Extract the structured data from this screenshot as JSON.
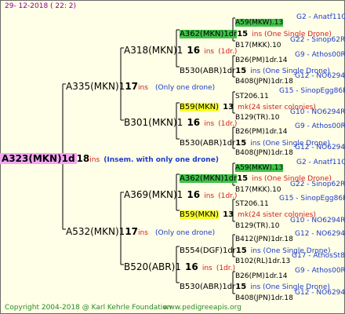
{
  "header": {
    "date": "29- 12-2018 ( 22:  2)"
  },
  "footer": {
    "copyright": "Copyright 2004-2018 @ Karl Kehrle Foundation",
    "site": "www.pedigreeapis.org"
  },
  "root": {
    "label": "A323(MKN)1d",
    "ins": "18",
    "ins_suffix": "ins",
    "note": "(Insem. with only one drone)"
  },
  "level1": [
    {
      "label": "A335(MKN)1",
      "ins": "17",
      "ins_suffix": "ins",
      "note": "(Only one drone)"
    },
    {
      "label": "A532(MKN)1",
      "ins": "17",
      "ins_suffix": "ins",
      "note": "(Only one drone)"
    }
  ],
  "level2": [
    {
      "label": "A318(MKN)1",
      "ins": "16",
      "ins_suffix": "ins",
      "note": "(1dr.)"
    },
    {
      "label": "B301(MKN)1",
      "ins": "16",
      "ins_suffix": "ins",
      "note": "(1dr.)"
    },
    {
      "label": "A369(MKN)1",
      "ins": "16",
      "ins_suffix": "ins",
      "note": "(1dr.)"
    },
    {
      "label": "B520(ABR)1",
      "ins": "16",
      "ins_suffix": "ins",
      "note": "(1dr.)"
    }
  ],
  "level3": [
    {
      "label": "A362(MKN)1dr",
      "ins": "15",
      "note": "ins (One Single Drone)"
    },
    {
      "label": "B530(ABR)1dr",
      "ins": "15",
      "note": "ins (One Single Drone)"
    },
    {
      "label": "B59(MKN)",
      "ins": "13",
      "note": "mk(24 sister colonies)"
    },
    {
      "label": "B530(ABR)1dr",
      "ins": "15",
      "note": "ins (One Single Drone)"
    },
    {
      "label": "A362(MKN)1dr",
      "ins": "15",
      "note": "ins (One Single Drone)"
    },
    {
      "label": "B59(MKN)",
      "ins": "13",
      "note": "mk(24 sister colonies)"
    },
    {
      "label": "B554(DGF)1dr",
      "ins": "15",
      "note": "ins (One Single Drone)"
    },
    {
      "label": "B530(ABR)1dr",
      "ins": "15",
      "note": "ins (One Single Drone)"
    }
  ],
  "level4": [
    {
      "label": "A59(MKW).13",
      "meta": "G2 - Anatf11Q"
    },
    {
      "label": "B17(MKK).10",
      "meta": "G22 - Sinop62R"
    },
    {
      "label": "B26(PM)1dr.14",
      "meta": "G9 - Athos00R"
    },
    {
      "label": "B408(JPN)1dr.18",
      "meta": "G12 - NO6294R"
    },
    {
      "label": "ST206.11",
      "meta": "G15 - SinopEgg86R"
    },
    {
      "label": "B129(TR).10",
      "meta": "G10 - NO6294R"
    },
    {
      "label": "B26(PM)1dr.14",
      "meta": "G9 - Athos00R"
    },
    {
      "label": "B408(JPN)1dr.18",
      "meta": "G12 - NO6294R"
    },
    {
      "label": "A59(MKW).13",
      "meta": "G2 - Anatf11Q"
    },
    {
      "label": "B17(MKK).10",
      "meta": "G22 - Sinop62R"
    },
    {
      "label": "ST206.11",
      "meta": "G15 - SinopEgg86R"
    },
    {
      "label": "B129(TR).10",
      "meta": "G10 - NO6294R"
    },
    {
      "label": "B412(JPN)1dr.18",
      "meta": "G12 - NO6294R"
    },
    {
      "label": "B102(RL)1dr.13",
      "meta": "G17 - AthosSt80R"
    },
    {
      "label": "B26(PM)1dr.14",
      "meta": "G9 - Athos00R"
    },
    {
      "label": "B408(JPN)1dr.18",
      "meta": "G12 - NO6294R"
    }
  ]
}
